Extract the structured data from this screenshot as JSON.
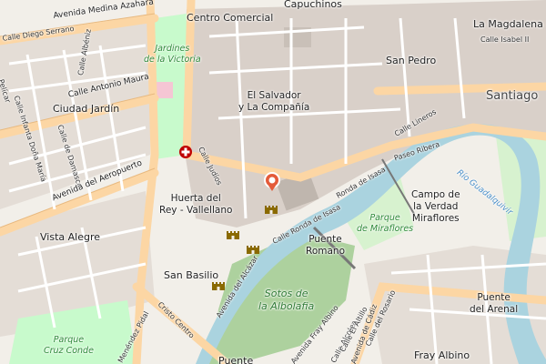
{
  "map": {
    "colors": {
      "land": "#f2efe9",
      "building": "#d9d0c9",
      "water": "#aad3df",
      "park": "#c8facc",
      "park_dark": "#add19e",
      "primary_road": "#fcd6a4",
      "residential_road": "#ffffff",
      "river_label": "#4a8fc9",
      "park_label": "#2f8a3a",
      "marker": "#e45b3a",
      "hospital": "#bf0000",
      "monument": "#8a6a00"
    },
    "places": {
      "centro_comercial": "Centro Comercial",
      "capuchinos": "Capuchinos",
      "la_magdalena": "La Magdalena",
      "san_pedro": "San Pedro",
      "santiago": "Santiago",
      "el_salvador_1": "El Salvador",
      "el_salvador_2": "y La Compañía",
      "ciudad_jardin": "Ciudad Jardín",
      "huerta_1": "Huerta del",
      "huerta_2": "Rey - Vallellano",
      "vista_alegre": "Vista Alegre",
      "san_basilio": "San Basilio",
      "puente_romano_1": "Puente",
      "puente_romano_2": "Romano",
      "campo_verdad_1": "Campo de",
      "campo_verdad_2": "la Verdad",
      "campo_verdad_3": "Miraflores",
      "puente_arenal_1": "Puente",
      "puente_arenal_2": "del Arenal",
      "fray_albino": "Fray Albino",
      "puente_bottom": "Puente"
    },
    "parks": {
      "jardines_1": "Jardines",
      "jardines_2": "de la Victoria",
      "miraflores_1": "Parque",
      "miraflores_2": "de Miraflores",
      "sotos_1": "Sotos de",
      "sotos_2": "la Albolafia",
      "cruz_conde_1": "Parque",
      "cruz_conde_2": "Cruz Conde"
    },
    "river": "Río Guadalquivir",
    "streets": {
      "medina_azahara": "Avenida Medina Azahara",
      "diego_serrano": "Calle Diego Serrano",
      "albeniz": "Calle Albéniz",
      "antonio_maura": "Calle Antonio Maura",
      "infanta_dona_maria": "Calle Infanta Doña María",
      "damasco": "Calle de Damasco",
      "aeropuerto": "Avenida del Aeropuerto",
      "pelicar": "Pelícar",
      "isabel_ii": "Calle Isabel II",
      "lineros": "Calle Lineros",
      "paseo_ribera": "Paseo Ribera",
      "judios": "Calle Judíos",
      "ronda_isasa": "Calle Ronda de Isasa",
      "ronda_isasa_2": "Ronda de Isasa",
      "alcazar": "Avenida del Alcázar",
      "fray_albino": "Avenida Fray Albino",
      "cristo_centro": "Cristo Centro",
      "pidal": "Menéndez Pidal",
      "alcolea": "Calle Alcolea",
      "cadiz": "Avenida de Cádiz",
      "rosario": "Calle del Rosario",
      "el_altillo": "Calle El Altillo"
    }
  }
}
